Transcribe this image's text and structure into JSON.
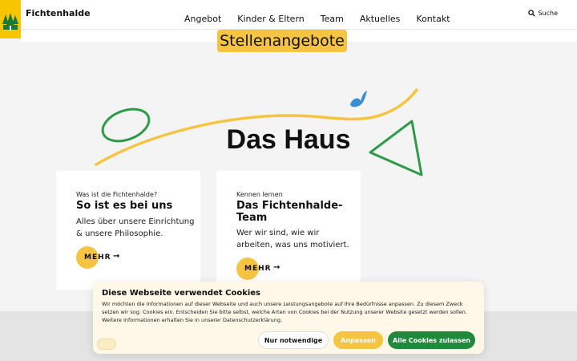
{
  "header": {
    "brand": "Fichtenhalde",
    "nav": [
      "Angebot",
      "Kinder & Eltern",
      "Team",
      "Aktuelles",
      "Kontakt"
    ],
    "search_label": "Suche"
  },
  "tag": "Stellenangebote",
  "hero_title": "Das Haus",
  "cards": [
    {
      "kicker": "Was ist die Fichtenhalde?",
      "title": "So ist es bei uns",
      "description": "Alles über unsere Einrichtung & unsere Philosophie.",
      "more": "MEHR"
    },
    {
      "kicker": "Kennen lernen",
      "title": "Das Fichtenhalde-Team",
      "description": "Wer wir sind, wie wir arbeiten, was uns motiviert.",
      "more": "MEHR"
    }
  ],
  "cookie": {
    "title": "Diese Webseite verwendet Cookies",
    "text": "Wir möchten die Informationen auf dieser Webseite und auch unsere Leistungsangebote auf Ihre Bedürfnisse anpassen. Zu diesem Zweck setzen wir sog. Cookies ein. Entscheiden Sie bitte selbst, welche Arten von Cookies bei der Nutzung unserer Website gesetzt werden sollen. Weitere Informationen erhalten Sie in unserer Datenschutzerklärung.",
    "btn_necessary": "Nur notwendige",
    "btn_adjust": "Anpassen",
    "btn_all": "Alle Cookies zulassen"
  },
  "colors": {
    "yellow": "#f5c443",
    "green": "#1f8a3c",
    "blue": "#3a8fd0"
  }
}
